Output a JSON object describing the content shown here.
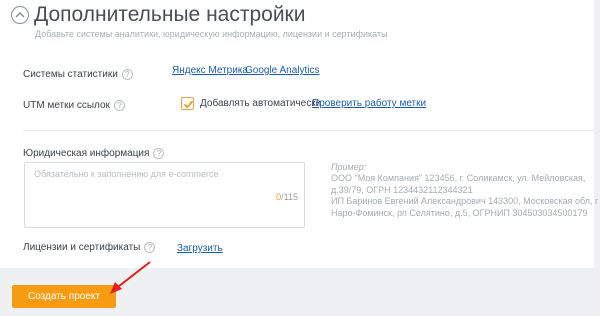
{
  "header": {
    "title": "Дополнительные настройки",
    "subtitle": "Добавьте системы аналитики, юридическую информацию, лицензии и сертификаты"
  },
  "stats": {
    "label": "Системы статистики",
    "help": "?",
    "links": [
      "Яндекс Метрика",
      "Google Analytics"
    ]
  },
  "utm": {
    "label": "UTM метки ссылок",
    "help": "?",
    "checkbox_label": "Добавлять автоматически",
    "checked": true,
    "check_link": "Проверить работу метки"
  },
  "legal": {
    "label": "Юридическая информация",
    "help": "?",
    "placeholder": "Обязательно к заполнению для e-commerce",
    "counter_current": "0",
    "counter_max": "/115",
    "example_title": "Пример:",
    "example_lines": [
      "ООО \"Моя Компания\" 123456, г. Соликамск, ул. Мейловская,",
      "д.39/79, ОГРН 1234432112344321",
      "ИП Баринов Евгений Александрович 143300, Московская обл, г",
      "Наро-Фоминск, рп Селятино, д.5, ОГРНИП 304503034500179"
    ]
  },
  "licenses": {
    "label": "Лицензии и сертификаты",
    "help": "?",
    "upload_link": "Загрузить"
  },
  "submit_label": "Создать проект",
  "colors": {
    "accent": "#f79c12",
    "link": "#1c5ba6",
    "annotation_arrow": "#e02020"
  }
}
